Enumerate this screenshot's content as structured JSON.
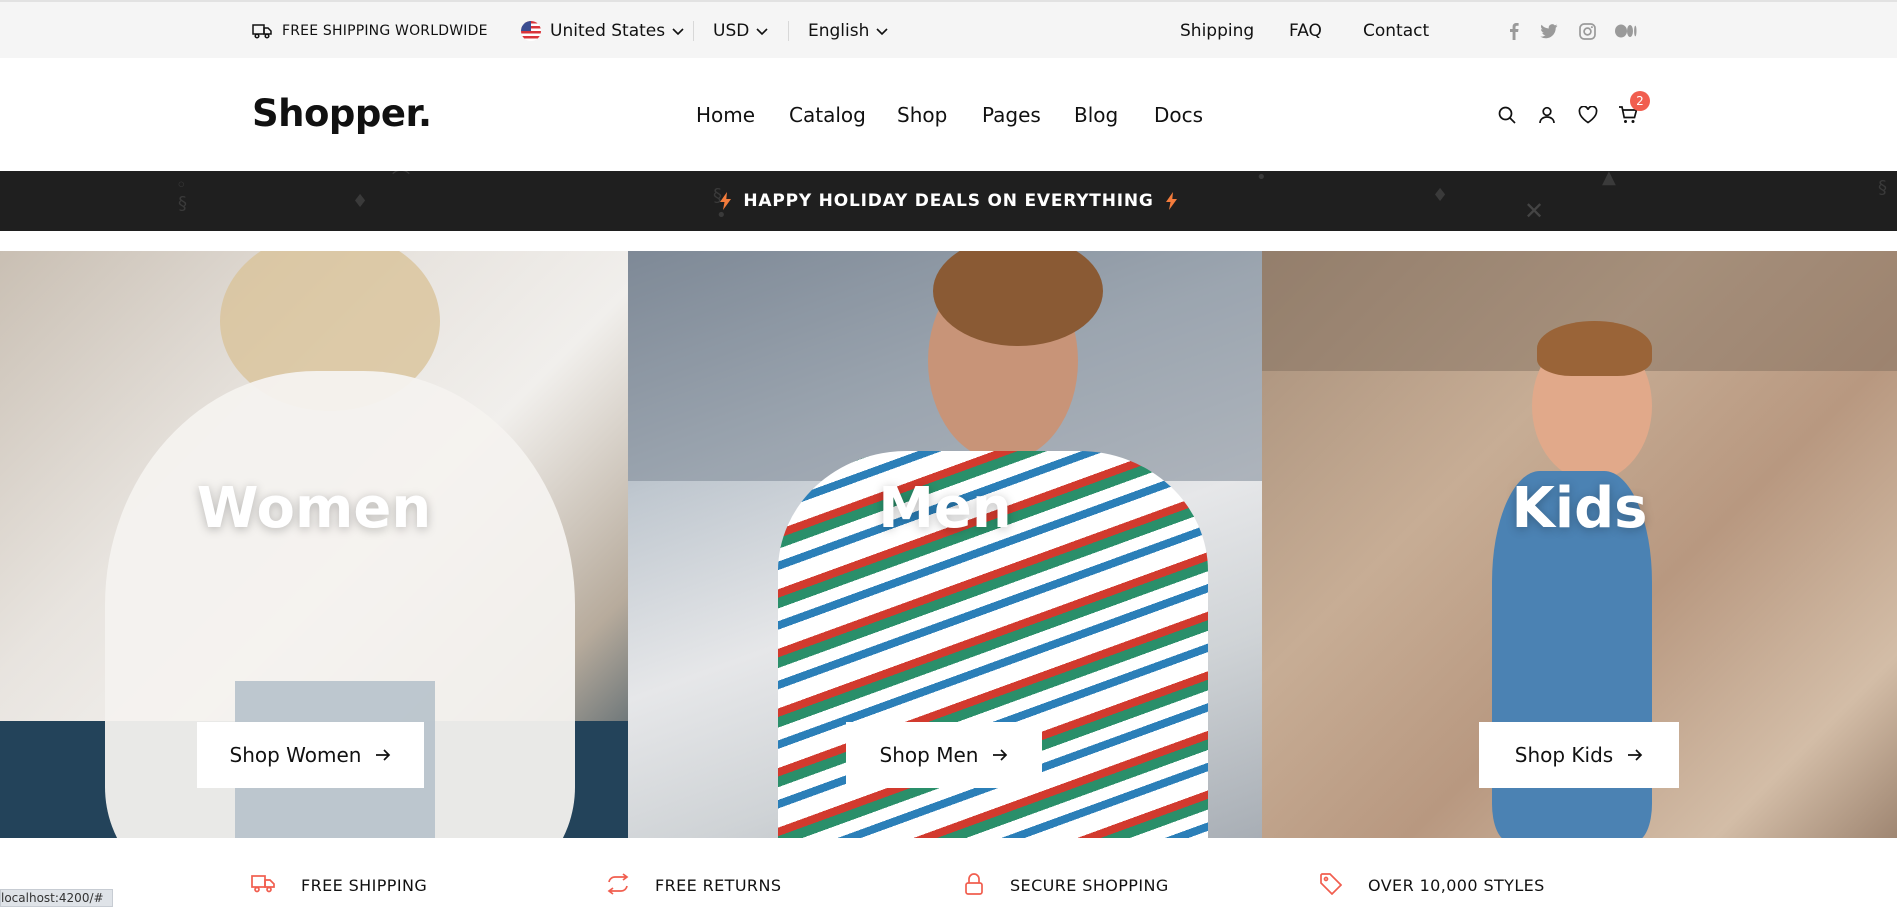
{
  "topbar": {
    "shipping_note": "FREE SHIPPING WORLDWIDE",
    "country": "United States",
    "currency": "USD",
    "language": "English",
    "links": {
      "shipping": "Shipping",
      "faq": "FAQ",
      "contact": "Contact"
    },
    "social_icons": [
      "facebook-icon",
      "twitter-icon",
      "instagram-icon",
      "medium-icon"
    ]
  },
  "header": {
    "logo": "Shopper.",
    "nav": {
      "home": "Home",
      "catalog": "Catalog",
      "shop": "Shop",
      "pages": "Pages",
      "blog": "Blog",
      "docs": "Docs"
    },
    "icons": [
      "search-icon",
      "user-icon",
      "heart-icon",
      "cart-icon"
    ],
    "cart_count": "2"
  },
  "promo": {
    "text": "HAPPY HOLIDAY DEALS ON EVERYTHING",
    "icon": "lightning-icon"
  },
  "categories": [
    {
      "title": "Women",
      "button": "Shop Women"
    },
    {
      "title": "Men",
      "button": "Shop Men"
    },
    {
      "title": "Kids",
      "button": "Shop Kids"
    }
  ],
  "features": [
    {
      "label": "FREE SHIPPING",
      "icon": "truck-icon"
    },
    {
      "label": "FREE RETURNS",
      "icon": "returns-icon"
    },
    {
      "label": "SECURE SHOPPING",
      "icon": "lock-icon"
    },
    {
      "label": "OVER 10,000 STYLES",
      "icon": "tag-icon"
    }
  ],
  "status_url": "localhost:4200/#",
  "colors": {
    "accent": "#f15e4f",
    "promo_bg": "#1f1f1f",
    "topbar_bg": "#f5f5f5",
    "bolt": "#f47c3c"
  }
}
